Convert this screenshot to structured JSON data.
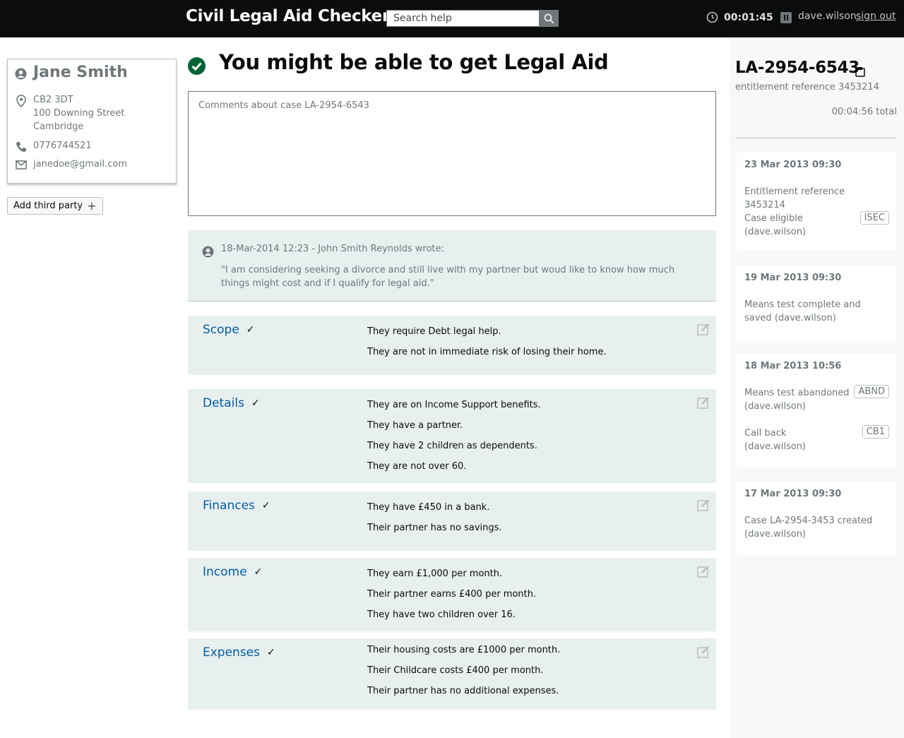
{
  "header": {
    "title": "Civil Legal Aid Checker",
    "search_placeholder": "Search help",
    "timer": "00:01:45",
    "username": "dave.wilson",
    "signout": "sign out"
  },
  "person": {
    "name": "Jane Smith",
    "postcode": "CB2 3DT",
    "street": "100 Downing Street",
    "city": "Cambridge",
    "phone": "0776744521",
    "email": "janedoe@gmail.com",
    "add_third_party": "Add third party"
  },
  "result": {
    "title": "You might be able to get Legal Aid",
    "comments_placeholder": "Comments about case LA-2954-6543"
  },
  "note": {
    "meta": "18-Mar-2014 12:23 - John Smith Reynolds wrote:",
    "quote": "\"I am considering seeking a divorce and still live with my partner but woud like to know how much things might cost and if I qualify for legal aid.\""
  },
  "sections": [
    {
      "title": "Scope",
      "lines": [
        "They require Debt legal help.",
        "They are not in immediate risk of losing their home."
      ]
    },
    {
      "title": "Details",
      "lines": [
        "They are on Income Support benefits.",
        "They have a partner.",
        "They have 2 children as dependents.",
        "They are not over 60."
      ]
    },
    {
      "title": "Finances",
      "lines": [
        "They have £450 in a bank.",
        "Their partner has no savings."
      ]
    },
    {
      "title": "Income",
      "lines": [
        "They earn £1,000 per month.",
        "Their partner earns £400 per month.",
        "They have two children over 16."
      ]
    },
    {
      "title": "Expenses",
      "lines": [
        "Their housing costs are £1000 per month.",
        "Their Childcare costs £400 per month.",
        "Their partner has no additional expenses."
      ]
    }
  ],
  "case": {
    "ref": "LA-2954-6543",
    "entitlement": "entitlement reference 3453214",
    "total": "00:04:56 total"
  },
  "events": [
    {
      "date": "23 Mar 2013 09:30",
      "items": [
        {
          "text": "Entitlement reference 3453214",
          "tag": ""
        },
        {
          "text": "Case eligible (dave.wilson)",
          "tag": "ISEC"
        }
      ]
    },
    {
      "date": "19 Mar 2013 09:30",
      "items": [
        {
          "text": "Means test complete and saved (dave.wilson)",
          "tag": ""
        }
      ]
    },
    {
      "date": "18 Mar 2013 10:56",
      "items": [
        {
          "text": "Means test abandoned (dave.wilson)",
          "tag": "ABND"
        },
        {
          "text": "Call back (dave.wilson)",
          "tag": "CB1"
        }
      ]
    },
    {
      "date": "17 Mar 2013 09:30",
      "items": [
        {
          "text": "Case LA-2954-3453 created (dave.wilson)",
          "tag": ""
        }
      ]
    }
  ]
}
